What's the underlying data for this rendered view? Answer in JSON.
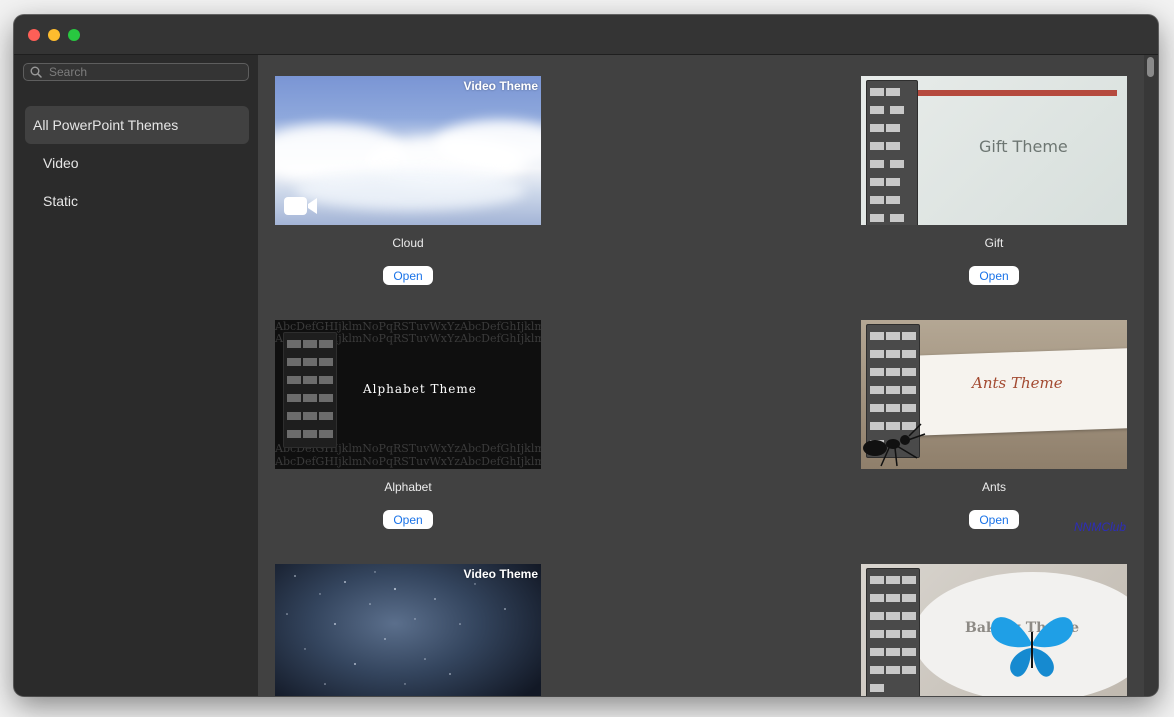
{
  "window": {
    "traffic_lights": [
      "#fe5f57",
      "#febc2e",
      "#28c840"
    ]
  },
  "sidebar": {
    "search_placeholder": "Search",
    "items": [
      {
        "label": "All PowerPoint Themes",
        "selected": true
      },
      {
        "label": "Video",
        "selected": false
      },
      {
        "label": "Static",
        "selected": false
      }
    ]
  },
  "themes": [
    {
      "name": "Cloud",
      "badge": "Video Theme",
      "button": "Open",
      "video": true
    },
    {
      "name": "Gift",
      "thumb_text": "Gift Theme",
      "button": "Open",
      "video": false
    },
    {
      "name": "Alphabet",
      "thumb_text": "Alphabet Theme",
      "button": "Open",
      "video": false
    },
    {
      "name": "Ants",
      "thumb_text": "Ants Theme",
      "button": "Open",
      "video": false
    },
    {
      "name": "",
      "badge": "Video Theme",
      "button": "",
      "video": true
    },
    {
      "name": "",
      "thumb_text": "Baking Theme",
      "button": "",
      "video": false
    }
  ],
  "alphabet_strip_text": "AbcDefGHIjklmNoPqRSTuvWxYzAbcDefGhIjklmNop",
  "watermark": "NNMClub",
  "colors": {
    "accent": "#1a73e8",
    "sidebar_bg": "#2b2b2b",
    "content_bg": "#414141"
  }
}
